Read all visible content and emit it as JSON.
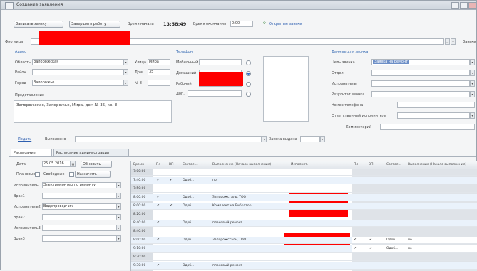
{
  "window": {
    "title": "Создание заявления"
  },
  "toolbar": {
    "btn1": "Записать заявку",
    "btn2": "Завершить работу",
    "start_label": "Время начала",
    "start_value": "13:58:49",
    "end_label": "Время окончания",
    "end_value": "0:00",
    "link": "Открытые заявки"
  },
  "fio_label": "Фио лица",
  "fio_btn": "Заявки",
  "address": {
    "title": "Адрес",
    "region_label": "Область",
    "region_value": "Запорожская",
    "street_label": "Улица",
    "street_value": "Мира",
    "district_label": "Район",
    "house_label": "Дом",
    "house_value": "35",
    "city_label": "Город",
    "city_value": "Запорожье",
    "flat_label": "№ 8",
    "flat_value": "",
    "repr_label": "Представление",
    "repr_value": "Запорожская, Запорожье, Мира, дом № 35, кв. 8"
  },
  "phones": {
    "title": "Телефон",
    "mobile_label": "Мобильный",
    "home_label": "Домашний",
    "work_label": "Рабочий",
    "extra_label": "Доп."
  },
  "call_data": {
    "title": "Данные для звонка",
    "f1": "Цель звонка",
    "f1_value": "Заявка на ремонт",
    "f2": "Отдел",
    "f3": "Исполнитель",
    "f4": "Результат звонка",
    "f5": "Номер телефона",
    "f6": "Ответственный исполнитель",
    "f7": "Комментарий"
  },
  "mid": {
    "link": "Подать",
    "field_label": "Выполнено",
    "right_label": "Заявка выдана",
    "tab1": "Расписание",
    "tab2": "Расписание администрации"
  },
  "left_panel": {
    "date_label": "Дата",
    "date_value": "25.05.2016",
    "btn_refresh": "Обновить",
    "plan_label": "Плановые",
    "free_label": "Свободные",
    "assign_label": "Назначить",
    "exec_label": "Исполнитель",
    "exec_value": "Электромонтер по ремонту",
    "w1_label": "Врач1",
    "exec2_label": "Исполнитель2",
    "exec2_value": "Водопроводчик",
    "w2_label": "Врач2",
    "exec3_label": "Исполнитель3",
    "w3_label": "Врач3"
  },
  "grid": {
    "headers": [
      "Время",
      "Пл",
      "ВП",
      "Состоя...",
      "Выполнение (Начало выполнения)",
      "Исполнит.",
      "Пл",
      "ВП",
      "Состоя...",
      "Выполнение (Начало выполнения)"
    ],
    "rows": [
      {
        "time": "7:00:00",
        "pl": "",
        "vp": "",
        "state": "",
        "work": "",
        "right": ""
      },
      {
        "time": "7:40:00",
        "pl": "✔",
        "vp": "✔",
        "state": "Одоб...",
        "work": "по",
        "right": ""
      },
      {
        "time": "7:50:00",
        "pl": "",
        "vp": "",
        "state": "",
        "work": "",
        "right": ""
      },
      {
        "time": "8:00:00",
        "pl": "✔",
        "vp": "",
        "state": "Одоб...",
        "work": "Запорожсталь, ТОО",
        "right": ""
      },
      {
        "time": "8:00:00",
        "pl": "✔",
        "vp": "✔",
        "state": "Одоб...",
        "work": "Комплект на Вибратор",
        "right": ""
      },
      {
        "time": "8:20:00",
        "pl": "",
        "vp": "",
        "state": "",
        "work": "",
        "right": ""
      },
      {
        "time": "8:40:00",
        "pl": "✔",
        "vp": "",
        "state": "Одоб...",
        "work": "плановый ремонт",
        "right": ""
      },
      {
        "time": "8:40:00",
        "pl": "",
        "vp": "",
        "state": "",
        "work": "",
        "right": ""
      },
      {
        "time": "9:00:00",
        "pl": "✔",
        "vp": "",
        "state": "Одоб...",
        "work": "Запорожсталь, ТОО",
        "right": "по"
      },
      {
        "time": "9:10:00",
        "pl": "",
        "vp": "",
        "state": "",
        "work": "",
        "right": "по"
      },
      {
        "time": "9:20:00",
        "pl": "",
        "vp": "",
        "state": "",
        "work": "",
        "right": ""
      },
      {
        "time": "9:30:00",
        "pl": "✔",
        "vp": "",
        "state": "Одоб...",
        "work": "плановый ремонт",
        "right": ""
      }
    ],
    "right_pl": "✔",
    "right_vp": "✔",
    "right_state": "Одоб..."
  },
  "colors": {
    "accent": "#3c6fb5",
    "redaction": "#ff0000",
    "row_alt": "#eaf2fb",
    "highlight": "#6d8fc7"
  }
}
